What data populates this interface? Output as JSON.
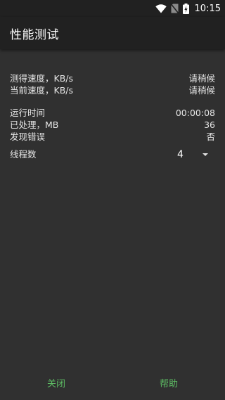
{
  "status_bar": {
    "time": "10:15",
    "icons": [
      "wifi-icon",
      "no-sim-icon",
      "battery-charging-icon"
    ]
  },
  "app_bar": {
    "title": "性能测试"
  },
  "stats": {
    "measured_speed": {
      "label": "测得速度，KB/s",
      "value": "请稍候"
    },
    "current_speed": {
      "label": "当前速度，KB/s",
      "value": "请稍候"
    },
    "runtime": {
      "label": "运行时间",
      "value": "00:00:08"
    },
    "processed": {
      "label": "已处理，MB",
      "value": "36"
    },
    "errors": {
      "label": "发现错误",
      "value": "否"
    }
  },
  "threads": {
    "label": "线程数",
    "selected": "4"
  },
  "buttons": {
    "close": "关闭",
    "help": "帮助"
  },
  "colors": {
    "background": "#303030",
    "bar": "#212121",
    "accent": "#5dbb63"
  }
}
